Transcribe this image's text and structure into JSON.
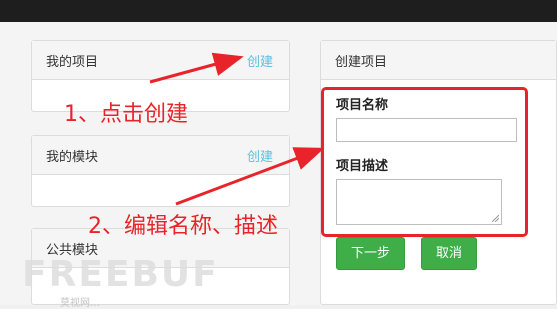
{
  "my_projects": {
    "title": "我的项目",
    "create_link": "创建"
  },
  "my_modules": {
    "title": "我的模块",
    "create_link": "创建"
  },
  "public_modules": {
    "title": "公共模块"
  },
  "create_project": {
    "title": "创建项目",
    "name_label": "项目名称",
    "name_value": "",
    "desc_label": "项目描述",
    "desc_value": "",
    "next_button": "下一步",
    "cancel_button": "取消"
  },
  "annotations": {
    "step1": "1、点击创建",
    "step2": "2、编辑名称、描述"
  },
  "watermark": {
    "brand": "FREEBUF",
    "sub": "莫视网…"
  },
  "colors": {
    "accent_link": "#5bc0de",
    "button_green": "#3fae49",
    "annotation_red": "#e8242a"
  }
}
